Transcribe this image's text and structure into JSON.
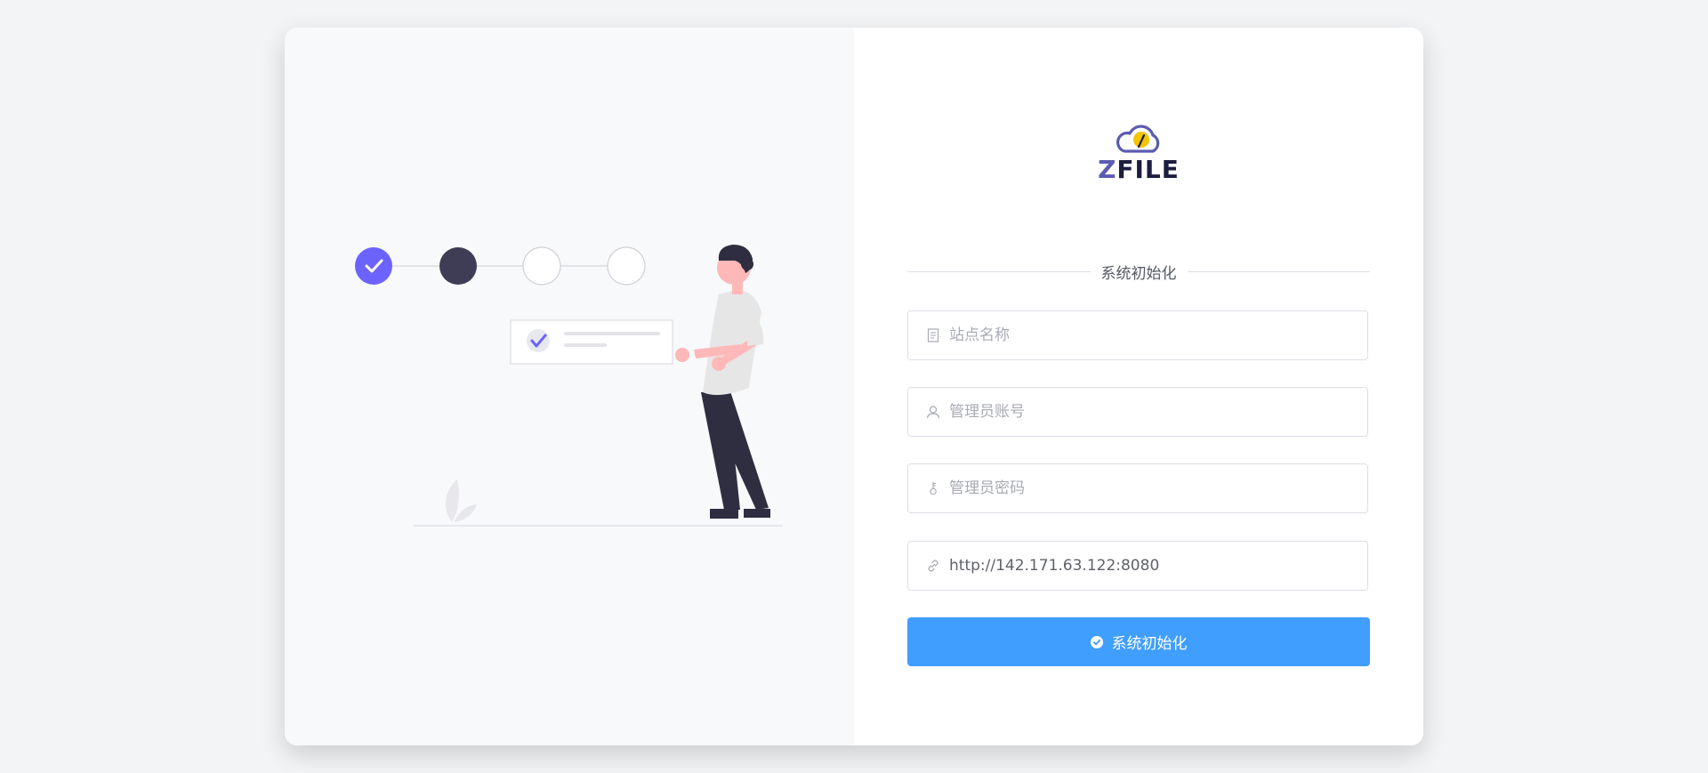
{
  "logo": {
    "brand_prefix": "Z",
    "brand_rest": "FILE",
    "icon": "cloud-icon"
  },
  "form": {
    "title": "系统初始化",
    "site_name": {
      "placeholder": "站点名称",
      "value": "",
      "icon": "document-icon"
    },
    "admin_username": {
      "placeholder": "管理员账号",
      "value": "",
      "icon": "user-icon"
    },
    "admin_password": {
      "placeholder": "管理员密码",
      "value": "",
      "icon": "key-icon"
    },
    "domain": {
      "placeholder": "",
      "value": "http://142.171.63.122:8080",
      "icon": "link-icon"
    },
    "submit_label": "系统初始化",
    "submit_icon": "circle-check-icon"
  },
  "colors": {
    "primary_button": "#409eff",
    "accent_purple": "#6c63ff",
    "logo_yellow": "#f2c500",
    "dark_figure": "#2f2e41"
  }
}
